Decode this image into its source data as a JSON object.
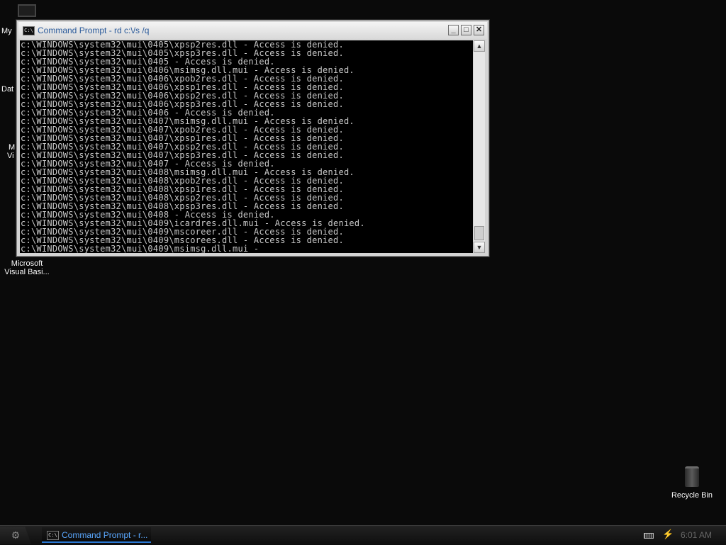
{
  "desktop": {
    "icons": [
      {
        "label": "My"
      },
      {
        "label": "Dat"
      },
      {
        "label": "M"
      },
      {
        "label": "Vi"
      },
      {
        "label_line1": "Microsoft",
        "label_line2": "Visual Basi..."
      }
    ],
    "recycle_bin": {
      "label": "Recycle Bin"
    }
  },
  "window": {
    "title": "Command Prompt - rd c:\\/s /q",
    "icon_text": "C:\\",
    "buttons": {
      "minimize": "_",
      "maximize": "□",
      "close": "✕"
    },
    "console_lines": [
      "c:\\WINDOWS\\system32\\mui\\0405\\xpsp2res.dll - Access is denied.",
      "c:\\WINDOWS\\system32\\mui\\0405\\xpsp3res.dll - Access is denied.",
      "c:\\WINDOWS\\system32\\mui\\0405 - Access is denied.",
      "c:\\WINDOWS\\system32\\mui\\0406\\msimsg.dll.mui - Access is denied.",
      "c:\\WINDOWS\\system32\\mui\\0406\\xpob2res.dll - Access is denied.",
      "c:\\WINDOWS\\system32\\mui\\0406\\xpsp1res.dll - Access is denied.",
      "c:\\WINDOWS\\system32\\mui\\0406\\xpsp2res.dll - Access is denied.",
      "c:\\WINDOWS\\system32\\mui\\0406\\xpsp3res.dll - Access is denied.",
      "c:\\WINDOWS\\system32\\mui\\0406 - Access is denied.",
      "c:\\WINDOWS\\system32\\mui\\0407\\msimsg.dll.mui - Access is denied.",
      "c:\\WINDOWS\\system32\\mui\\0407\\xpob2res.dll - Access is denied.",
      "c:\\WINDOWS\\system32\\mui\\0407\\xpsp1res.dll - Access is denied.",
      "c:\\WINDOWS\\system32\\mui\\0407\\xpsp2res.dll - Access is denied.",
      "c:\\WINDOWS\\system32\\mui\\0407\\xpsp3res.dll - Access is denied.",
      "c:\\WINDOWS\\system32\\mui\\0407 - Access is denied.",
      "c:\\WINDOWS\\system32\\mui\\0408\\msimsg.dll.mui - Access is denied.",
      "c:\\WINDOWS\\system32\\mui\\0408\\xpob2res.dll - Access is denied.",
      "c:\\WINDOWS\\system32\\mui\\0408\\xpsp1res.dll - Access is denied.",
      "c:\\WINDOWS\\system32\\mui\\0408\\xpsp2res.dll - Access is denied.",
      "c:\\WINDOWS\\system32\\mui\\0408\\xpsp3res.dll - Access is denied.",
      "c:\\WINDOWS\\system32\\mui\\0408 - Access is denied.",
      "c:\\WINDOWS\\system32\\mui\\0409\\icardres.dll.mui - Access is denied.",
      "c:\\WINDOWS\\system32\\mui\\0409\\mscoreer.dll - Access is denied.",
      "c:\\WINDOWS\\system32\\mui\\0409\\mscorees.dll - Access is denied.",
      "c:\\WINDOWS\\system32\\mui\\0409\\msimsg.dll.mui -"
    ],
    "scroll": {
      "up_arrow": "▲",
      "down_arrow": "▼"
    }
  },
  "taskbar": {
    "start_glyph": "⚙",
    "task": {
      "icon_text": "C:\\",
      "label": "Command Prompt - r..."
    },
    "tray": {
      "network_glyph": "⚡",
      "clock": "6:01 AM"
    }
  }
}
